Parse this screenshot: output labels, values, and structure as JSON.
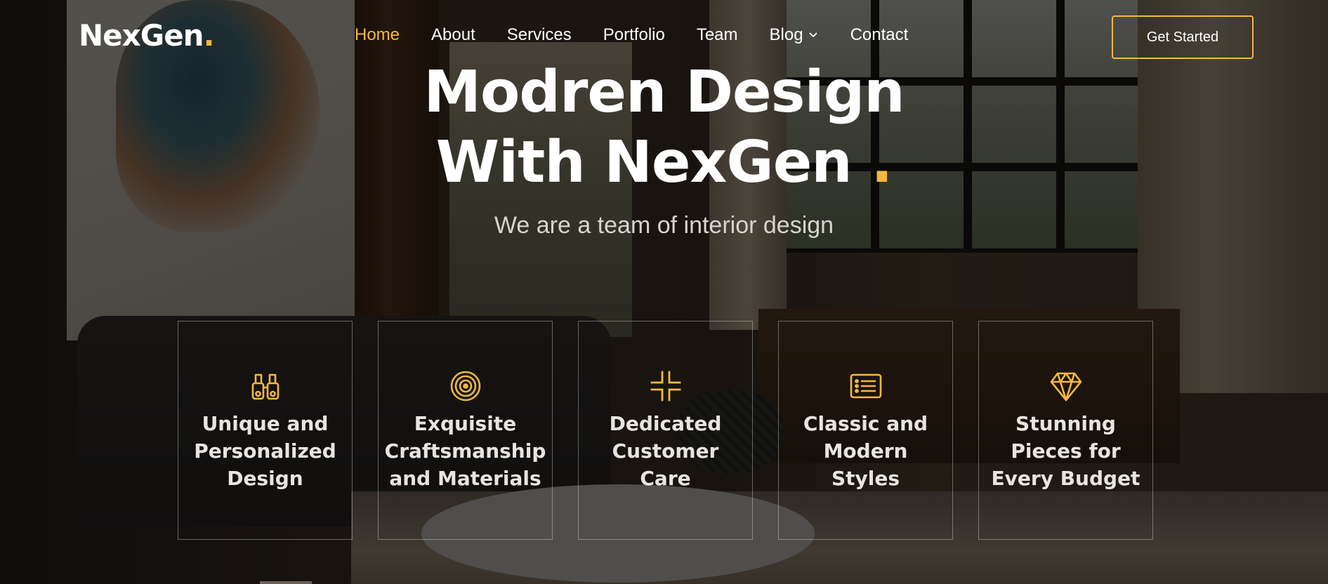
{
  "brand": {
    "name": "NexGen",
    "dot": ".",
    "accent_color": "#f5b840"
  },
  "nav": {
    "items": [
      {
        "label": "Home",
        "active": true
      },
      {
        "label": "About",
        "active": false
      },
      {
        "label": "Services",
        "active": false
      },
      {
        "label": "Portfolio",
        "active": false
      },
      {
        "label": "Team",
        "active": false
      },
      {
        "label": "Blog",
        "active": false,
        "has_dropdown": true
      },
      {
        "label": "Contact",
        "active": false
      }
    ]
  },
  "cta": {
    "label": "Get Started"
  },
  "hero": {
    "title_line1": "Modren Design",
    "title_line2": "With NexGen",
    "title_dot": ".",
    "subtitle": "We are a team of interior design"
  },
  "features": [
    {
      "label": "Unique and Personalized Design",
      "icon": "binoculars-icon"
    },
    {
      "label": "Exquisite Craftsmanship and Materials",
      "icon": "target-icon"
    },
    {
      "label": "Dedicated Customer Care",
      "icon": "fullscreen-exit-icon"
    },
    {
      "label": "Classic and Modern Styles",
      "icon": "list-card-icon"
    },
    {
      "label": "Stunning Pieces for Every Budget",
      "icon": "gem-icon"
    }
  ]
}
